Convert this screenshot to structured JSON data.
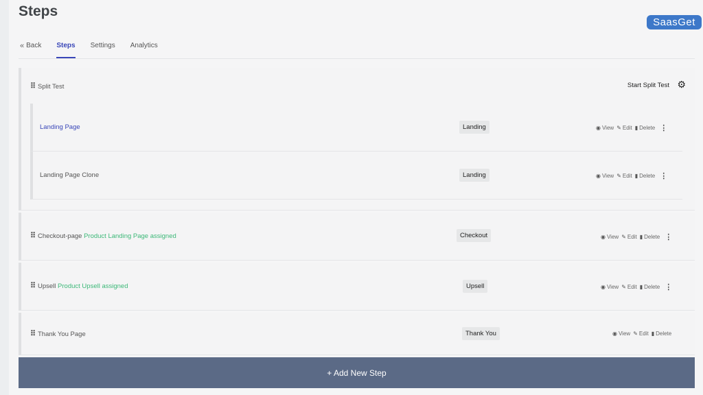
{
  "page": {
    "title": "Steps"
  },
  "watermark": "SaasGet",
  "tabs": [
    {
      "label": "Back",
      "icon": "double-chevron-left-icon"
    },
    {
      "label": "Steps",
      "active": true
    },
    {
      "label": "Settings"
    },
    {
      "label": "Analytics"
    }
  ],
  "split_test": {
    "title": "Split Test",
    "start_label": "Start Split Test",
    "pages": [
      {
        "name": "Landing Page",
        "type": "Landing",
        "color": "#3946b8"
      },
      {
        "name": "Landing Page Clone",
        "type": "Landing"
      }
    ]
  },
  "steps": [
    {
      "name": "Checkout-page",
      "assigned": "Product Landing Page assigned",
      "type": "Checkout"
    },
    {
      "name": "Upsell",
      "assigned": "Product Upsell assigned",
      "type": "Upsell"
    },
    {
      "name": "Thank You Page",
      "assigned": "",
      "type": "Thank You"
    }
  ],
  "actions": {
    "view": "View",
    "edit": "Edit",
    "delete": "Delete"
  },
  "add_step": {
    "label": "+ Add New Step"
  },
  "colors": {
    "accent": "#3946b8",
    "assigned": "#3cb878",
    "add_bar": "#5b6a86"
  }
}
